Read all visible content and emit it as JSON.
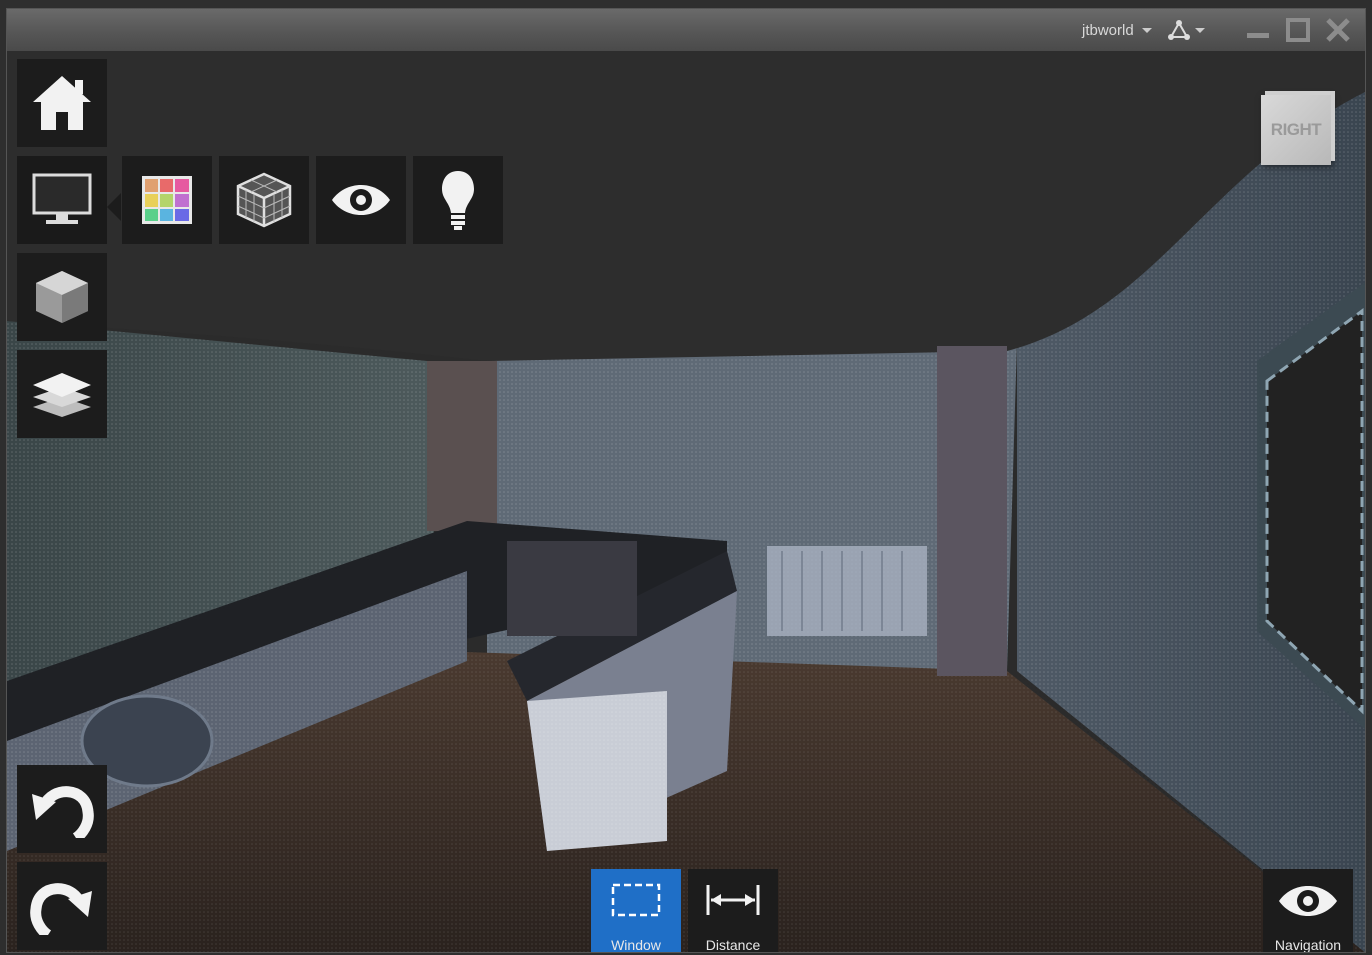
{
  "titlebar": {
    "user_label": "jtbworld"
  },
  "viewcube": {
    "face_label": "RIGHT"
  },
  "left_toolbar": {
    "items": [
      "home-icon",
      "display-icon",
      "model-cube-icon",
      "layers-icon",
      "undo-icon",
      "redo-icon"
    ]
  },
  "display_submenu": {
    "items": [
      "color-palette-icon",
      "wireframe-cube-icon",
      "eye-icon",
      "lightbulb-icon"
    ]
  },
  "bottom_toolbar": {
    "window_label": "Window",
    "distance_label": "Distance",
    "navigation_label": "Navigation"
  },
  "colors": {
    "active_button": "#1f6fc7",
    "toolbar_bg": "#1c1c1c",
    "titlebar_bg": "#5a5a5a"
  }
}
